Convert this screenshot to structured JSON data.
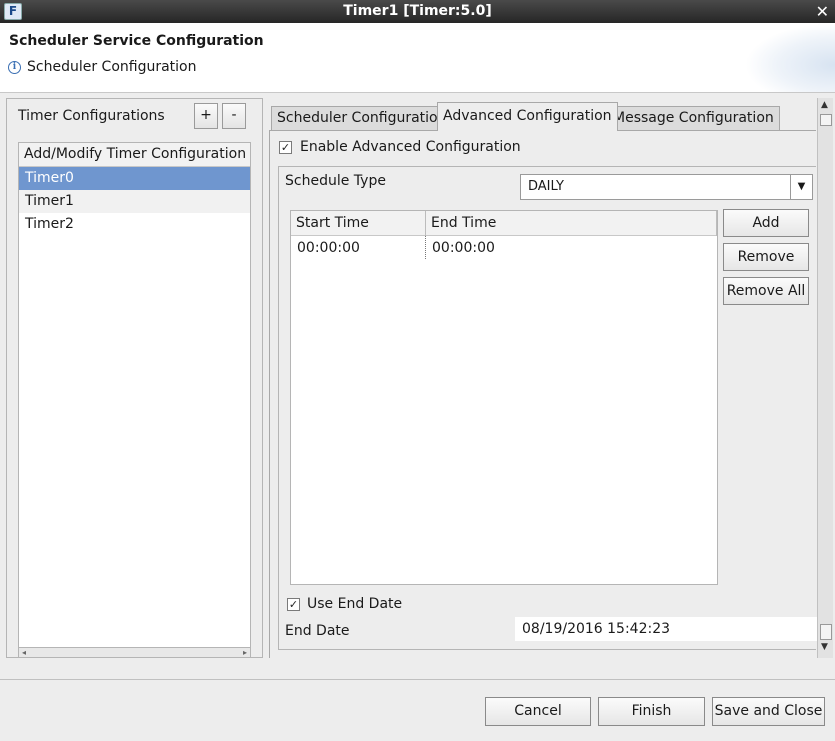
{
  "window": {
    "title": "Timer1 [Timer:5.0]",
    "app_icon_glyph": "F",
    "close_glyph": "✕"
  },
  "header": {
    "title": "Scheduler Service Configuration",
    "subtitle": "Scheduler Configuration",
    "info_glyph": "i"
  },
  "left": {
    "label": "Timer Configurations",
    "add_label": "+",
    "remove_label": "-",
    "list_header": "Add/Modify Timer Configuration",
    "items": [
      "Timer0",
      "Timer1",
      "Timer2"
    ],
    "selected_index": 0
  },
  "tabs": [
    {
      "label": "Scheduler Configuration",
      "active": false
    },
    {
      "label": "Advanced Configuration",
      "active": true
    },
    {
      "label": "Message Configuration",
      "active": false
    }
  ],
  "advanced": {
    "enable_label": "Enable Advanced Configuration",
    "enable_checked": true,
    "schedule_type_label": "Schedule Type",
    "schedule_type_value": "DAILY",
    "columns": [
      "Start Time",
      "End Time"
    ],
    "rows": [
      [
        "00:00:00",
        "00:00:00"
      ]
    ],
    "add_label": "Add",
    "remove_label": "Remove",
    "remove_all_label": "Remove All",
    "use_end_date_label": "Use End Date",
    "use_end_date_checked": true,
    "end_date_label": "End Date",
    "end_date_value": "08/19/2016 15:42:23"
  },
  "footer": {
    "cancel_label": "Cancel",
    "finish_label": "Finish",
    "save_close_label": "Save and Close"
  },
  "icons": {
    "check_glyph": "✓",
    "dropdown_glyph": "▼",
    "scroll_up": "▲",
    "scroll_down": "▼",
    "scroll_left": "◂",
    "scroll_right": "▸"
  },
  "colors": {
    "selection": "#6f96cf",
    "titlebar": "#2e2e2e",
    "background": "#ededed"
  }
}
